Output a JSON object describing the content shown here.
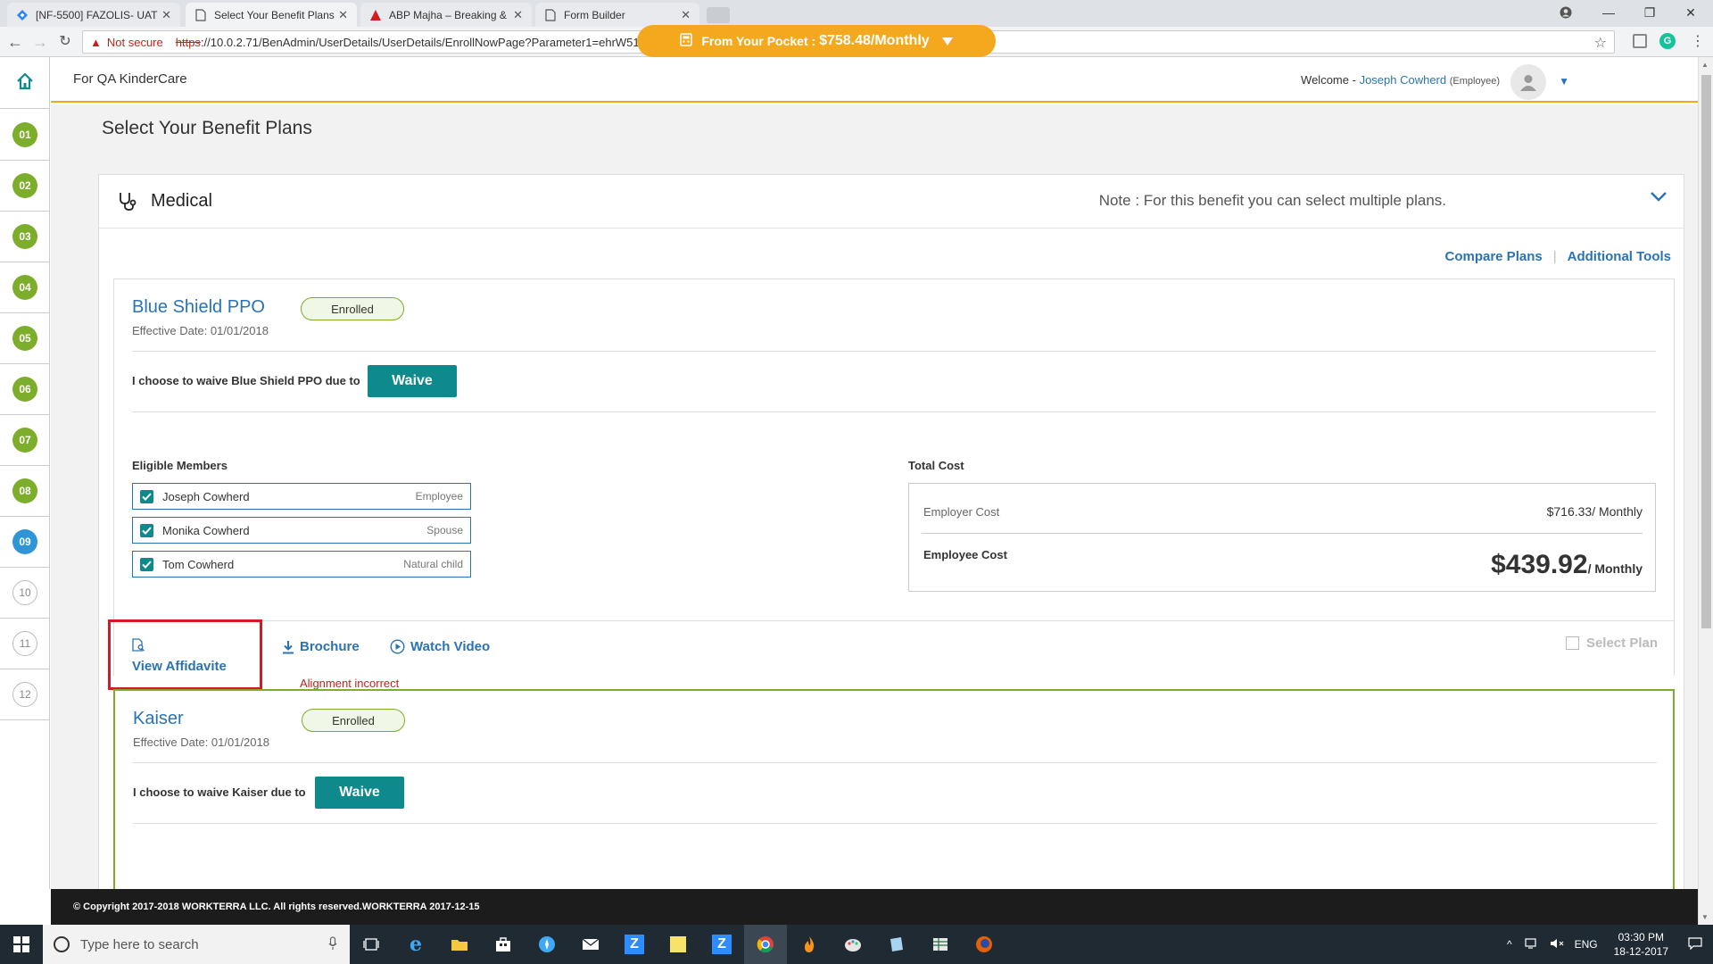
{
  "browser": {
    "tabs": [
      {
        "label": "[NF-5500] FAZOLIS- UAT"
      },
      {
        "label": "Select Your Benefit Plans"
      },
      {
        "label": "ABP Majha – Breaking &"
      },
      {
        "label": "Form Builder"
      }
    ],
    "security_label": "Not secure",
    "url_scheme": "https",
    "url_rest": "://10.0.2.71/BenAdmin/UserDetails/UserDetails/EnrollNowPage?Parameter1=ehrW513Mh4KtBhGbYLN6HA%3d%3d"
  },
  "rail": {
    "steps": [
      {
        "label": "01",
        "state": "done"
      },
      {
        "label": "02",
        "state": "done"
      },
      {
        "label": "03",
        "state": "done"
      },
      {
        "label": "04",
        "state": "done"
      },
      {
        "label": "05",
        "state": "done"
      },
      {
        "label": "06",
        "state": "done"
      },
      {
        "label": "07",
        "state": "done"
      },
      {
        "label": "08",
        "state": "done"
      },
      {
        "label": "09",
        "state": "current"
      },
      {
        "label": "10",
        "state": "todo"
      },
      {
        "label": "11",
        "state": "todo"
      },
      {
        "label": "12",
        "state": "todo"
      }
    ]
  },
  "header": {
    "client": "For QA KinderCare",
    "pocket_label": "From Your Pocket :",
    "pocket_amount": "$758.48/Monthly",
    "welcome": "Welcome -",
    "user_name": "Joseph Cowherd",
    "user_role": "(Employee)"
  },
  "page": {
    "title": "Select Your Benefit Plans"
  },
  "benefit": {
    "name": "Medical",
    "note": "Note : For this benefit you can select multiple plans.",
    "compare_link": "Compare Plans",
    "tools_link": "Additional Tools"
  },
  "plans": [
    {
      "name": "Blue Shield PPO",
      "status": "Enrolled",
      "effective": "Effective Date: 01/01/2018",
      "waive_text": "I choose to waive Blue Shield PPO due to",
      "waive_btn": "Waive",
      "eligible_label": "Eligible Members",
      "members": [
        {
          "name": "Joseph Cowherd",
          "relation": "Employee"
        },
        {
          "name": "Monika Cowherd",
          "relation": "Spouse"
        },
        {
          "name": "Tom Cowherd",
          "relation": "Natural child"
        }
      ],
      "total_cost_label": "Total Cost",
      "employer_cost_label": "Employer Cost",
      "employer_cost": "$716.33/ Monthly",
      "employee_cost_label": "Employee Cost",
      "employee_cost": "$439.92",
      "employee_cost_per": "/ Monthly",
      "view_affidavit": "View Affidavite",
      "brochure": "Brochure",
      "watch_video": "Watch Video",
      "alignment_note": "Alignment incorrect",
      "select_plan": "Select Plan"
    },
    {
      "name": "Kaiser",
      "status": "Enrolled",
      "effective": "Effective Date: 01/01/2018",
      "waive_text": "I choose to waive Kaiser due to",
      "waive_btn": "Waive"
    }
  ],
  "footer": {
    "copyright": "© Copyright 2017-2018 WORKTERRA LLC. All rights reserved.WORKTERRA 2017-12-15"
  },
  "taskbar": {
    "search_placeholder": "Type here to search",
    "lang": "ENG",
    "time": "03:30 PM",
    "date": "18-12-2017"
  },
  "colors": {
    "accent_orange": "#f4a81d",
    "link_blue": "#2a73b3",
    "teal": "#0f8a8c",
    "step_green": "#7cae2b",
    "step_blue": "#2f95d6",
    "annotation_red": "#d71920"
  }
}
